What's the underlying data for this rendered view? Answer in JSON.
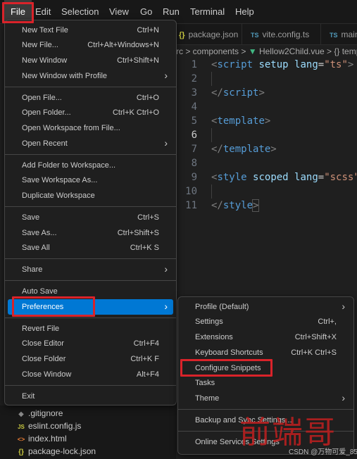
{
  "menubar": {
    "items": [
      "File",
      "Edit",
      "Selection",
      "View",
      "Go",
      "Run",
      "Terminal",
      "Help"
    ]
  },
  "tabs": [
    {
      "icon": "{}",
      "label": "package.json"
    },
    {
      "icon": "TS",
      "label": "vite.config.ts"
    },
    {
      "icon": "TS",
      "label": "main"
    }
  ],
  "breadcrumb": {
    "folder": "rc > components >",
    "vue_icon": "▼",
    "file": "Hellow2Child.vue >",
    "symbol": "{} templa"
  },
  "editor": {
    "line_numbers": [
      "1",
      "2",
      "3",
      "4",
      "5",
      "6",
      "7",
      "8",
      "9",
      "10",
      "11"
    ],
    "current_line": 6,
    "lines": {
      "l1": {
        "open": "<",
        "tag": "script",
        "a1": "setup",
        "a2": "lang",
        "eq": "=",
        "val": "\"ts\"",
        "close": ">"
      },
      "l3": {
        "open": "</",
        "tag": "script",
        "close": ">"
      },
      "l5": {
        "open": "<",
        "tag": "template",
        "close": ">"
      },
      "l7": {
        "open": "</",
        "tag": "template",
        "close": ">"
      },
      "l9": {
        "open": "<",
        "tag": "style",
        "a1": "scoped",
        "a2": "lang",
        "eq": "=",
        "val": "\"scss\""
      },
      "l11": {
        "open": "</",
        "tag": "style",
        "close": ">"
      }
    }
  },
  "file_menu": {
    "items": [
      {
        "label": "New Text File",
        "shortcut": "Ctrl+N"
      },
      {
        "label": "New File...",
        "shortcut": "Ctrl+Alt+Windows+N"
      },
      {
        "label": "New Window",
        "shortcut": "Ctrl+Shift+N"
      },
      {
        "label": "New Window with Profile",
        "arrow": "›"
      },
      {
        "label": "Open File...",
        "shortcut": "Ctrl+O"
      },
      {
        "label": "Open Folder...",
        "shortcut": "Ctrl+K Ctrl+O"
      },
      {
        "label": "Open Workspace from File..."
      },
      {
        "label": "Open Recent",
        "arrow": "›"
      },
      {
        "label": "Add Folder to Workspace..."
      },
      {
        "label": "Save Workspace As..."
      },
      {
        "label": "Duplicate Workspace"
      },
      {
        "label": "Save",
        "shortcut": "Ctrl+S"
      },
      {
        "label": "Save As...",
        "shortcut": "Ctrl+Shift+S"
      },
      {
        "label": "Save All",
        "shortcut": "Ctrl+K S"
      },
      {
        "label": "Share",
        "arrow": "›"
      },
      {
        "label": "Auto Save"
      },
      {
        "label": "Preferences",
        "arrow": "›"
      },
      {
        "label": "Revert File"
      },
      {
        "label": "Close Editor",
        "shortcut": "Ctrl+F4"
      },
      {
        "label": "Close Folder",
        "shortcut": "Ctrl+K F"
      },
      {
        "label": "Close Window",
        "shortcut": "Alt+F4"
      },
      {
        "label": "Exit"
      }
    ]
  },
  "preferences_menu": {
    "items": [
      {
        "label": "Profile (Default)",
        "arrow": "›"
      },
      {
        "label": "Settings",
        "shortcut": "Ctrl+,"
      },
      {
        "label": "Extensions",
        "shortcut": "Ctrl+Shift+X"
      },
      {
        "label": "Keyboard Shortcuts",
        "shortcut": "Ctrl+K Ctrl+S"
      },
      {
        "label": "Configure Snippets"
      },
      {
        "label": "Tasks"
      },
      {
        "label": "Theme",
        "arrow": "›"
      },
      {
        "label": "Backup and Sync Settings..."
      },
      {
        "label": "Online Services Settings"
      }
    ]
  },
  "explorer": {
    "files": [
      {
        "icon": "◆",
        "label": ".gitignore"
      },
      {
        "icon": "JS",
        "label": "eslint.config.js"
      },
      {
        "icon": "<>",
        "label": "index.html"
      },
      {
        "icon": "{}",
        "label": "package-lock.json"
      }
    ]
  },
  "watermark": {
    "text": "前端哥",
    "credit": "CSDN @万物可爱_85"
  },
  "colors": {
    "accent": "#0078d4",
    "highlight_box": "#d9232a",
    "menu_bg": "#1f1f1f"
  }
}
